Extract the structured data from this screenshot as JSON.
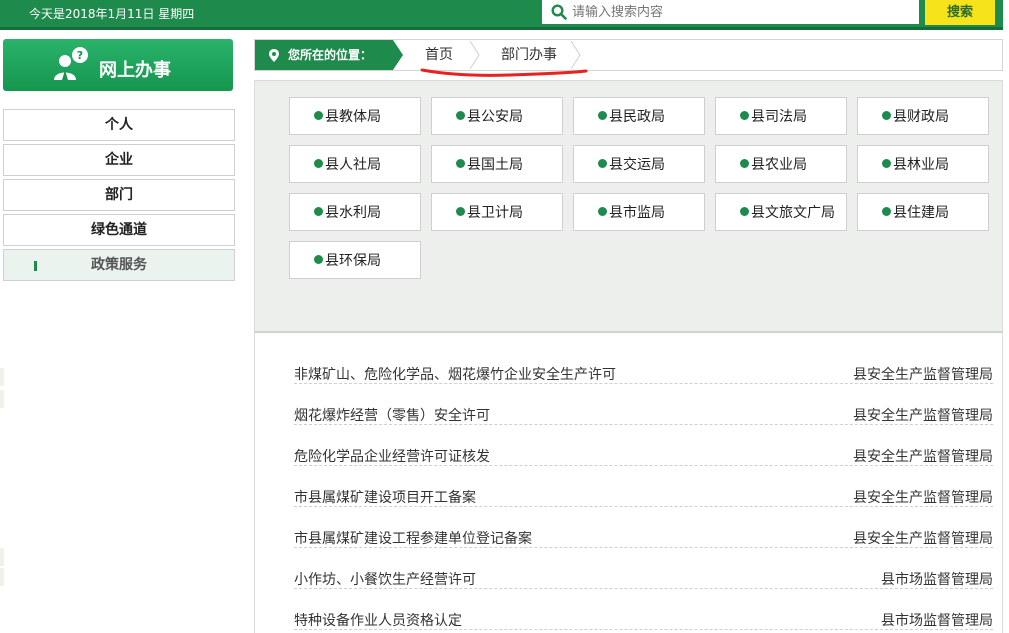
{
  "topbar": {
    "date_text": "今天是2018年1月11日  星期四",
    "search_placeholder": "请输入搜索内容",
    "search_button": "搜索"
  },
  "online": {
    "label": "网上办事"
  },
  "side_menu": [
    {
      "label": "个人",
      "active": false
    },
    {
      "label": "企业",
      "active": false
    },
    {
      "label": "部门",
      "active": false
    },
    {
      "label": "绿色通道",
      "active": false
    },
    {
      "label": "政策服务",
      "active": true
    }
  ],
  "breadcrumb": {
    "label": "您所在的位置：",
    "items": [
      "首页",
      "部门办事"
    ]
  },
  "departments": [
    "县教体局",
    "县公安局",
    "县民政局",
    "县司法局",
    "县财政局",
    "县人社局",
    "县国土局",
    "县交运局",
    "县农业局",
    "县林业局",
    "县水利局",
    "县卫计局",
    "县市监局",
    "县文旅文广局",
    "县住建局",
    "县环保局"
  ],
  "services": [
    {
      "title": "非煤矿山、危险化学品、烟花爆竹企业安全生产许可",
      "org": "县安全生产监督管理局"
    },
    {
      "title": "烟花爆炸经营（零售）安全许可",
      "org": "县安全生产监督管理局"
    },
    {
      "title": "危险化学品企业经营许可证核发",
      "org": "县安全生产监督管理局"
    },
    {
      "title": "市县属煤矿建设项目开工备案",
      "org": "县安全生产监督管理局"
    },
    {
      "title": "市县属煤矿建设工程参建单位登记备案",
      "org": "县安全生产监督管理局"
    },
    {
      "title": "小作坊、小餐饮生产经营许可",
      "org": "县市场监督管理局"
    },
    {
      "title": "特种设备作业人员资格认定",
      "org": "县市场监督管理局"
    }
  ],
  "colors": {
    "brand_green": "#1e8a4b",
    "search_yellow": "#f7e31a",
    "annotation_red": "#e8231f"
  }
}
